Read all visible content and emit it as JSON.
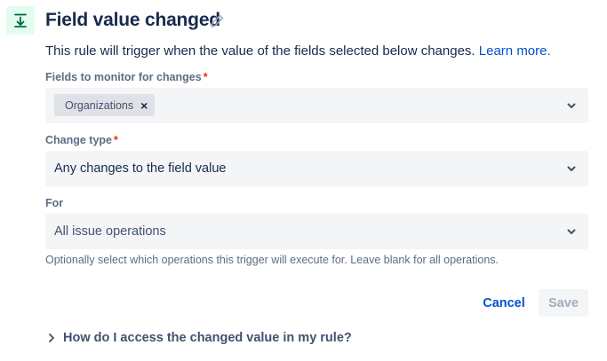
{
  "header": {
    "title": "Field value changed",
    "icon": "download-arrow-icon",
    "icon_bg": "#e3fcef",
    "icon_color": "#006644"
  },
  "description": {
    "text": "This rule will trigger when the value of the fields selected below changes.",
    "link": "Learn more."
  },
  "fields_to_monitor": {
    "label": "Fields to monitor for changes",
    "required_marker": "*",
    "selected_tags": [
      "Organizations"
    ],
    "remove_glyph": "×"
  },
  "change_type": {
    "label": "Change type",
    "required_marker": "*",
    "value": "Any changes to the field value"
  },
  "for_field": {
    "label": "For",
    "value": "All issue operations",
    "helper": "Optionally select which operations this trigger will execute for. Leave blank for all operations."
  },
  "actions": {
    "cancel": "Cancel",
    "save": "Save"
  },
  "expander": {
    "label": "How do I access the changed value in my rule?"
  },
  "colors": {
    "link": "#0052cc",
    "required": "#de350b",
    "field_bg": "#f4f5f7"
  }
}
